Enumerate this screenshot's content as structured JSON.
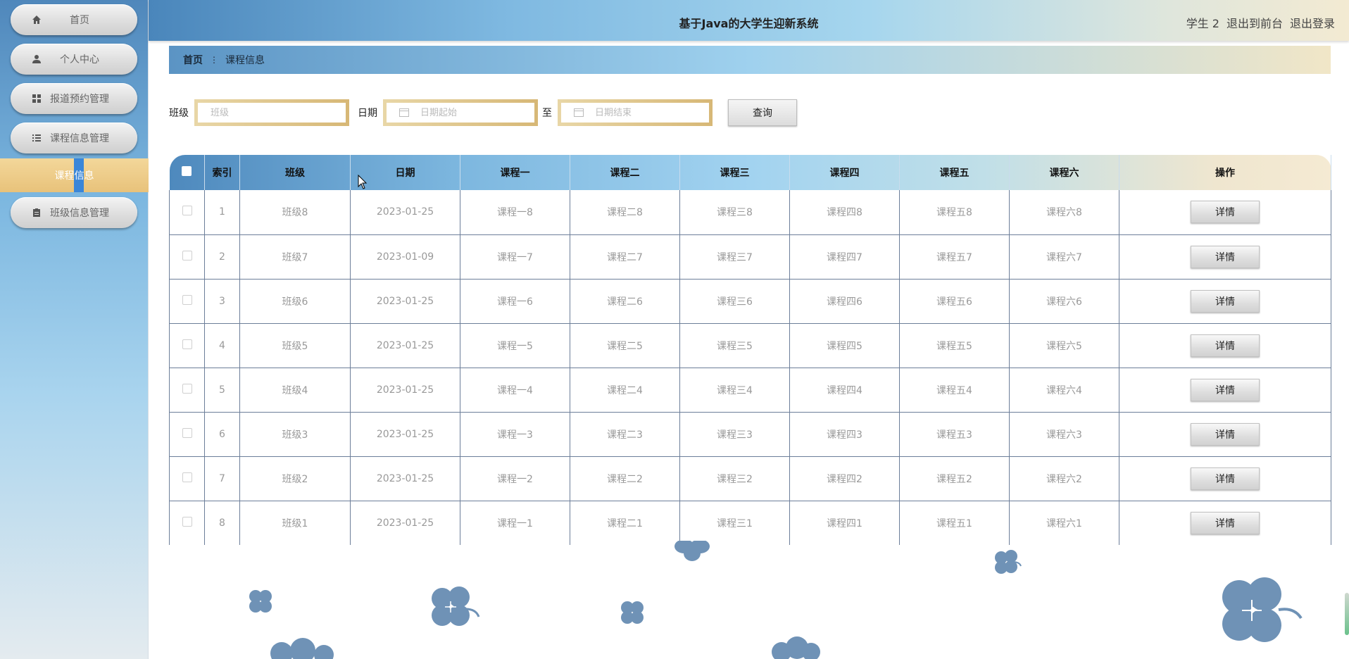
{
  "header": {
    "title": "基于Java的大学生迎新系统",
    "user": "学生 2",
    "front_link": "退出到前台",
    "logout_link": "退出登录"
  },
  "sidebar": {
    "items": [
      {
        "label": "首页",
        "icon": "home-icon"
      },
      {
        "label": "个人中心",
        "icon": "user-icon"
      },
      {
        "label": "报道预约管理",
        "icon": "grid-icon"
      },
      {
        "label": "课程信息管理",
        "icon": "list-icon"
      },
      {
        "label": "班级信息管理",
        "icon": "clipboard-icon"
      }
    ],
    "active_sub": "课程信息"
  },
  "breadcrumb": {
    "home": "首页",
    "current": "课程信息"
  },
  "search": {
    "class_label": "班级",
    "class_placeholder": "班级",
    "date_label": "日期",
    "start_placeholder": "日期起始",
    "to_label": "至",
    "end_placeholder": "日期结束",
    "query_button": "查询"
  },
  "table": {
    "headers": [
      "索引",
      "班级",
      "日期",
      "课程一",
      "课程二",
      "课程三",
      "课程四",
      "课程五",
      "课程六",
      "操作"
    ],
    "detail_label": "详情",
    "rows": [
      [
        "1",
        "班级8",
        "2023-01-25",
        "课程一8",
        "课程二8",
        "课程三8",
        "课程四8",
        "课程五8",
        "课程六8"
      ],
      [
        "2",
        "班级7",
        "2023-01-09",
        "课程一7",
        "课程二7",
        "课程三7",
        "课程四7",
        "课程五7",
        "课程六7"
      ],
      [
        "3",
        "班级6",
        "2023-01-25",
        "课程一6",
        "课程二6",
        "课程三6",
        "课程四6",
        "课程五6",
        "课程六6"
      ],
      [
        "4",
        "班级5",
        "2023-01-25",
        "课程一5",
        "课程二5",
        "课程三5",
        "课程四5",
        "课程五5",
        "课程六5"
      ],
      [
        "5",
        "班级4",
        "2023-01-25",
        "课程一4",
        "课程二4",
        "课程三4",
        "课程四4",
        "课程五4",
        "课程六4"
      ],
      [
        "6",
        "班级3",
        "2023-01-25",
        "课程一3",
        "课程二3",
        "课程三3",
        "课程四3",
        "课程五3",
        "课程六3"
      ],
      [
        "7",
        "班级2",
        "2023-01-25",
        "课程一2",
        "课程二2",
        "课程三2",
        "课程四2",
        "课程五2",
        "课程六2"
      ],
      [
        "8",
        "班级1",
        "2023-01-25",
        "课程一1",
        "课程二1",
        "课程三1",
        "课程四1",
        "课程五1",
        "课程六1"
      ]
    ]
  },
  "colors": {
    "flower": "#6f92b6",
    "active_sub_bg": "#eac77f",
    "active_bar": "#3a86d8"
  }
}
